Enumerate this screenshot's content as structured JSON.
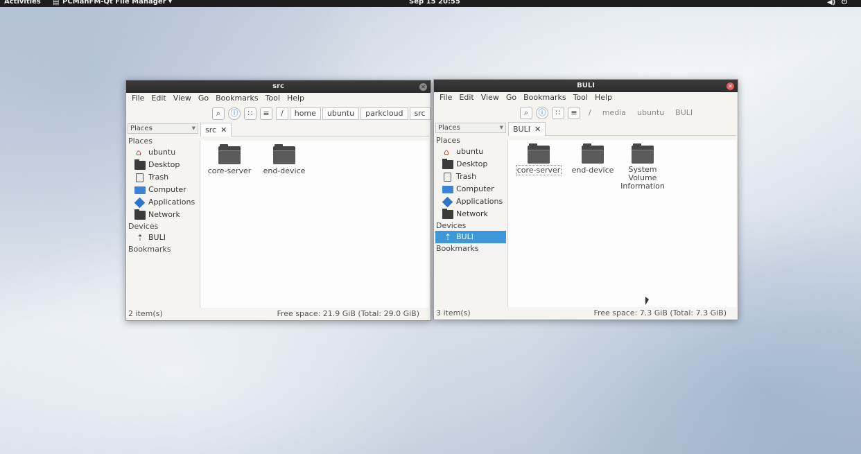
{
  "topbar": {
    "activities": "Activities",
    "app_menu": "PCManFM-Qt File Manager ▾",
    "clock": "Sep 15 20:55"
  },
  "left_window": {
    "title": "src",
    "menu": [
      "File",
      "Edit",
      "View",
      "Go",
      "Bookmarks",
      "Tool",
      "Help"
    ],
    "path": [
      "/",
      "home",
      "ubuntu",
      "parkcloud",
      "src"
    ],
    "places_select": "Places",
    "sidebar": {
      "places_header": "Places",
      "places": [
        "ubuntu",
        "Desktop",
        "Trash",
        "Computer",
        "Applications",
        "Network"
      ],
      "devices_header": "Devices",
      "devices": [
        "BULI"
      ],
      "bookmarks_header": "Bookmarks"
    },
    "tab": "src",
    "files": [
      "core-server",
      "end-device"
    ],
    "status_count": "2 item(s)",
    "status_space": "Free space: 21.9 GiB (Total: 29.0 GiB)"
  },
  "right_window": {
    "title": "BULI",
    "menu": [
      "File",
      "Edit",
      "View",
      "Go",
      "Bookmarks",
      "Tool",
      "Help"
    ],
    "path": [
      "/",
      "media",
      "ubuntu",
      "BULI"
    ],
    "places_select": "Places",
    "sidebar": {
      "places_header": "Places",
      "places": [
        "ubuntu",
        "Desktop",
        "Trash",
        "Computer",
        "Applications",
        "Network"
      ],
      "devices_header": "Devices",
      "devices": [
        "BULI"
      ],
      "bookmarks_header": "Bookmarks"
    },
    "tab": "BULI",
    "files": [
      "core-server",
      "end-device",
      "System Volume Information"
    ],
    "status_count": "3 item(s)",
    "status_space": "Free space: 7.3 GiB (Total: 7.3 GiB)"
  },
  "colors": {
    "selection": "#3d97d8",
    "titlebar": "#2c2c2c",
    "close_active": "#e25d5d"
  },
  "icons": [
    "close-icon",
    "search-icon",
    "info-icon",
    "icon-view-icon",
    "list-view-icon",
    "home-icon",
    "folder-icon",
    "trash-icon",
    "computer-icon",
    "applications-icon",
    "usb-drive-icon"
  ]
}
